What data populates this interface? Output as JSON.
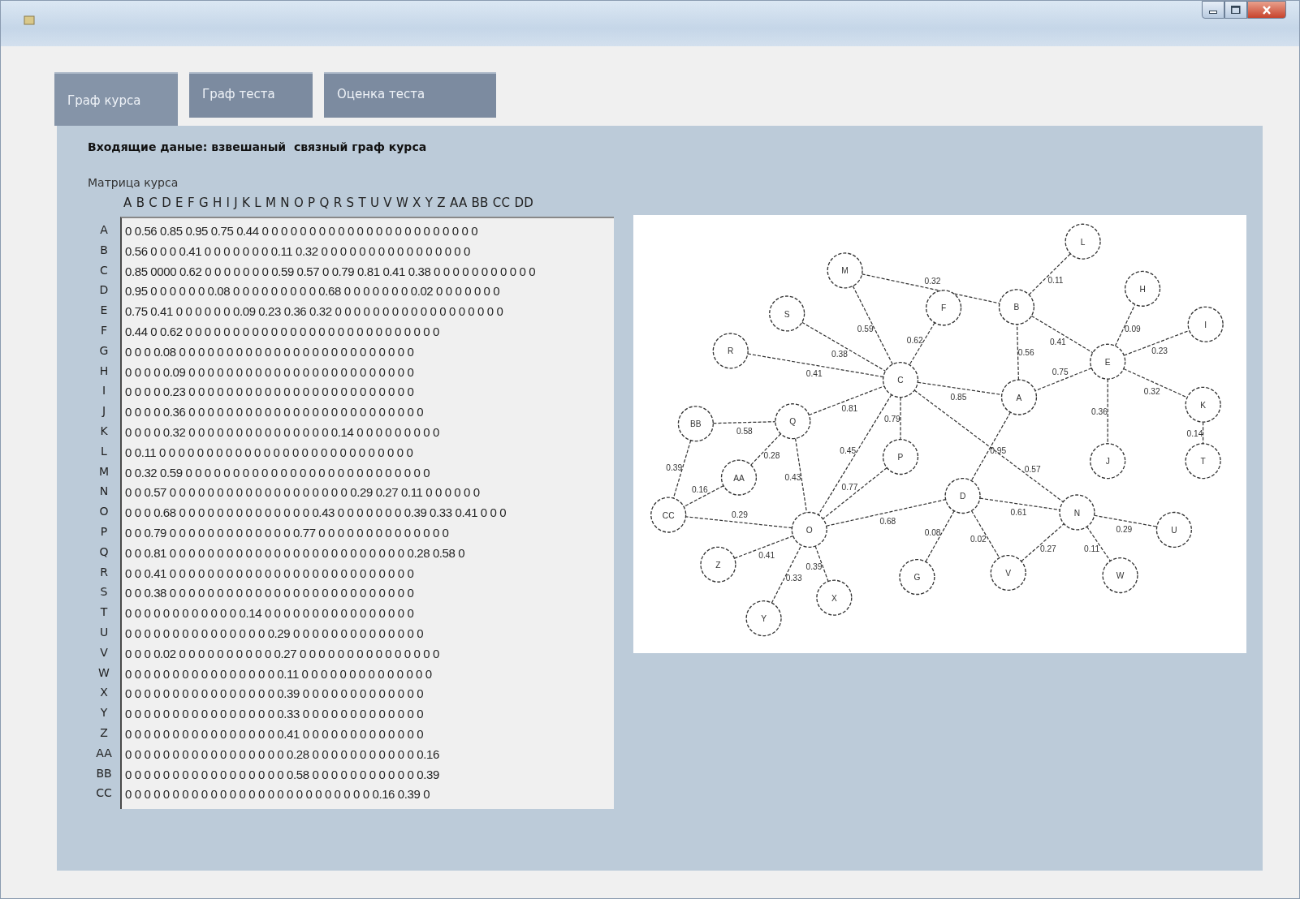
{
  "window": {
    "controls": [
      {
        "kind": "minimize"
      },
      {
        "kind": "maximize"
      },
      {
        "kind": "close"
      }
    ]
  },
  "tabs": [
    {
      "label": "Граф курса",
      "selected": true
    },
    {
      "label": "Граф теста",
      "selected": false
    },
    {
      "label": "Оценка теста",
      "selected": false
    }
  ],
  "heading": "Входящие даные: взвешаный  связный граф курса",
  "matrix": {
    "label": "Матрица курса",
    "columns_header": "A B C D E F G H I J K L M N O P Q R S T U V W X Y Z AA BB CC DD",
    "rows": [
      {
        "label": "A",
        "values": "0 0.56 0.85 0.95 0.75 0.44 0 0 0 0 0 0 0 0 0 0 0 0 0 0 0 0 0 0 0 0 0 0 0"
      },
      {
        "label": "B",
        "values": "0.56 0 0 0 0.41 0 0 0 0 0 0 0 0.11 0.32 0 0 0 0 0 0 0 0 0 0 0 0 0 0 0 0"
      },
      {
        "label": "C",
        "values": "0.85 0000 0.62 0 0 0 0 0 0 0 0.59 0.57 0 0.79 0.81 0.41 0.38 0 0 0 0 0 0 0 0 0 0 0"
      },
      {
        "label": "D",
        "values": "0.95 0 0 0 0 0 0 0.08 0 0 0 0 0 0 0 0 0 0.68 0 0 0 0 0 0 0 0.02 0 0 0 0 0 0 0"
      },
      {
        "label": "E",
        "values": "0.75 0.41 0 0 0 0 0 0 0.09 0.23 0.36 0.32 0 0 0 0 0 0 0 0 0 0 0 0 0 0 0 0 0 0"
      },
      {
        "label": "F",
        "values": "0.44 0 0.62 0 0 0 0 0 0 0 0 0 0 0 0 0 0 0 0 0 0 0 0 0 0 0 0 0 0 0"
      },
      {
        "label": "G",
        "values": "0 0 0 0.08 0 0 0 0 0 0 0 0 0 0 0 0 0 0 0 0 0 0 0 0 0 0 0 0 0"
      },
      {
        "label": "H",
        "values": "0 0 0 0 0.09 0 0 0 0 0 0 0 0 0 0 0 0 0 0 0 0 0 0 0 0 0 0 0 0"
      },
      {
        "label": "I",
        "values": "0 0 0 0 0.23 0 0 0 0 0 0 0 0 0 0 0 0 0 0 0 0 0 0 0 0 0 0 0 0"
      },
      {
        "label": "J",
        "values": "0 0 0 0 0.36 0 0 0 0 0 0 0 0 0 0 0 0 0 0 0 0 0 0 0 0 0 0 0 0 0"
      },
      {
        "label": "K",
        "values": "0 0 0 0 0.32 0 0 0 0 0 0 0 0 0 0 0 0 0 0 0 0.14 0 0 0 0 0 0 0 0 0"
      },
      {
        "label": "L",
        "values": "0 0.11 0 0 0 0 0 0 0 0 0 0 0 0 0 0 0 0 0 0 0 0 0 0 0 0 0 0 0"
      },
      {
        "label": "M",
        "values": "0 0.32 0.59 0 0 0 0 0 0 0 0 0 0 0 0 0 0 0 0 0 0 0 0 0 0 0 0 0 0"
      },
      {
        "label": "N",
        "values": "0 0 0.57 0 0 0 0 0 0 0 0 0 0 0 0 0 0 0 0 0 0 0 0.29 0.27 0.11 0 0 0 0 0 0"
      },
      {
        "label": "O",
        "values": "0 0 0 0.68 0 0 0 0 0 0 0 0 0 0 0 0 0 0 0.43 0 0 0 0 0 0 0 0.39 0.33 0.41 0 0 0"
      },
      {
        "label": "P",
        "values": "0 0 0.79 0 0 0 0 0 0 0 0 0 0 0 0 0 0.77 0 0 0 0 0 0 0 0 0 0 0 0 0 0"
      },
      {
        "label": "Q",
        "values": "0 0 0.81 0 0 0 0 0 0 0 0 0 0 0 0 0 0 0 0 0 0 0 0 0 0 0 0 0 0.28 0.58 0"
      },
      {
        "label": "R",
        "values": "0 0 0.41 0 0 0 0 0 0 0 0 0 0 0 0 0 0 0 0 0 0 0 0 0 0 0 0 0 0"
      },
      {
        "label": "S",
        "values": "0 0 0.38 0 0 0 0 0 0 0 0 0 0 0 0 0 0 0 0 0 0 0 0 0 0 0 0 0 0"
      },
      {
        "label": "T",
        "values": "0 0 0 0 0 0 0 0 0 0 0 0 0.14 0 0 0 0 0 0 0 0 0 0 0 0 0 0 0 0"
      },
      {
        "label": "U",
        "values": "0 0 0 0 0 0 0 0 0 0 0 0 0 0 0 0.29 0 0 0 0 0 0 0 0 0 0 0 0 0 0"
      },
      {
        "label": "V",
        "values": "0 0 0 0.02 0 0 0 0 0 0 0 0 0 0 0.27 0 0 0 0 0 0 0 0 0 0 0 0 0 0 0"
      },
      {
        "label": "W",
        "values": "0 0 0 0 0 0 0 0 0 0 0 0 0 0 0 0 0.11 0 0 0 0 0 0 0 0 0 0 0 0 0 0"
      },
      {
        "label": "X",
        "values": "0 0 0 0 0 0 0 0 0 0 0 0 0 0 0 0 0.39 0 0 0 0 0 0 0 0 0 0 0 0 0"
      },
      {
        "label": "Y",
        "values": "0 0 0 0 0 0 0 0 0 0 0 0 0 0 0 0 0.33 0 0 0 0 0 0 0 0 0 0 0 0 0"
      },
      {
        "label": "Z",
        "values": "0 0 0 0 0 0 0 0 0 0 0 0 0 0 0 0 0.41 0 0 0 0 0 0 0 0 0 0 0 0 0"
      },
      {
        "label": "AA",
        "values": "0 0 0 0 0 0 0 0 0 0 0 0 0 0 0 0 0 0.28 0 0 0 0 0 0 0 0 0 0 0 0.16"
      },
      {
        "label": "BB",
        "values": "0 0 0 0 0 0 0 0 0 0 0 0 0 0 0 0 0 0.58 0 0 0 0 0 0 0 0 0 0 0 0.39"
      },
      {
        "label": "CC",
        "values": "0 0 0 0 0 0 0 0 0 0 0 0 0 0 0 0 0 0 0 0 0 0 0 0 0 0 0.16 0.39 0"
      }
    ]
  },
  "graph": {
    "nodes": [
      {
        "label": "A"
      },
      {
        "label": "B"
      },
      {
        "label": "C"
      },
      {
        "label": "D"
      },
      {
        "label": "E"
      },
      {
        "label": "F"
      },
      {
        "label": "G"
      },
      {
        "label": "H"
      },
      {
        "label": "I"
      },
      {
        "label": "J"
      },
      {
        "label": "K"
      },
      {
        "label": "L"
      },
      {
        "label": "M"
      },
      {
        "label": "N"
      },
      {
        "label": "O"
      },
      {
        "label": "P"
      },
      {
        "label": "Q"
      },
      {
        "label": "R"
      },
      {
        "label": "S"
      },
      {
        "label": "T"
      },
      {
        "label": "U"
      },
      {
        "label": "V"
      },
      {
        "label": "W"
      },
      {
        "label": "X"
      },
      {
        "label": "Y"
      },
      {
        "label": "Z"
      },
      {
        "label": "AA"
      },
      {
        "label": "BB"
      },
      {
        "label": "CC"
      }
    ],
    "edges": [
      {
        "weight": "0.32"
      },
      {
        "weight": "0.11"
      },
      {
        "weight": "0.41"
      },
      {
        "weight": "0.56"
      },
      {
        "weight": "0.09"
      },
      {
        "weight": "0.23"
      },
      {
        "weight": "0.32"
      },
      {
        "weight": "0.75"
      },
      {
        "weight": "0.36"
      },
      {
        "weight": "0.14"
      },
      {
        "weight": "0.59"
      },
      {
        "weight": "0.38"
      },
      {
        "weight": "0.41"
      },
      {
        "weight": "0.62"
      },
      {
        "weight": "0.85"
      },
      {
        "weight": "0.79"
      },
      {
        "weight": "0.81"
      },
      {
        "weight": "0.45"
      },
      {
        "weight": "0.57"
      },
      {
        "weight": "0.95"
      },
      {
        "weight": "0.08"
      },
      {
        "weight": "0.02"
      },
      {
        "weight": "0.68"
      },
      {
        "weight": "0.61"
      },
      {
        "weight": "0.29"
      },
      {
        "weight": "0.27"
      },
      {
        "weight": "0.11"
      },
      {
        "weight": "0.43"
      },
      {
        "weight": "0.77"
      },
      {
        "weight": "0.29"
      },
      {
        "weight": "0.41"
      },
      {
        "weight": "0.33"
      },
      {
        "weight": "0.39"
      },
      {
        "weight": "0.58"
      },
      {
        "weight": "0.28"
      },
      {
        "weight": "0.39"
      },
      {
        "weight": "0.16"
      }
    ]
  }
}
